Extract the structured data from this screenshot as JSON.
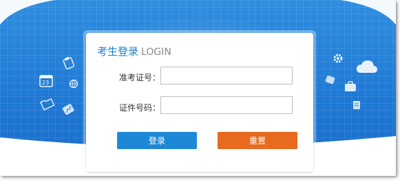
{
  "login": {
    "title_cn": "考生登录",
    "title_en": "LOGIN",
    "fields": [
      {
        "label": "准考证号：",
        "value": "",
        "placeholder": ""
      },
      {
        "label": "证件号码：",
        "value": "",
        "placeholder": ""
      }
    ],
    "buttons": {
      "login_label": "登录",
      "reset_label": "重置"
    }
  },
  "decor": {
    "left_icons": [
      "clipboard-icon",
      "calendar-icon",
      "globe-icon",
      "folder-icon",
      "chart-icon"
    ],
    "right_icons": [
      "gear-icon",
      "cloud-icon",
      "briefcase-icon",
      "tag-icon",
      "document-icon"
    ],
    "calendar_number": "23"
  },
  "colors": {
    "background_blue": "#1f79d4",
    "login_button": "#1f88d6",
    "reset_button": "#e86a1f",
    "title_blue": "#1b7fd0"
  }
}
